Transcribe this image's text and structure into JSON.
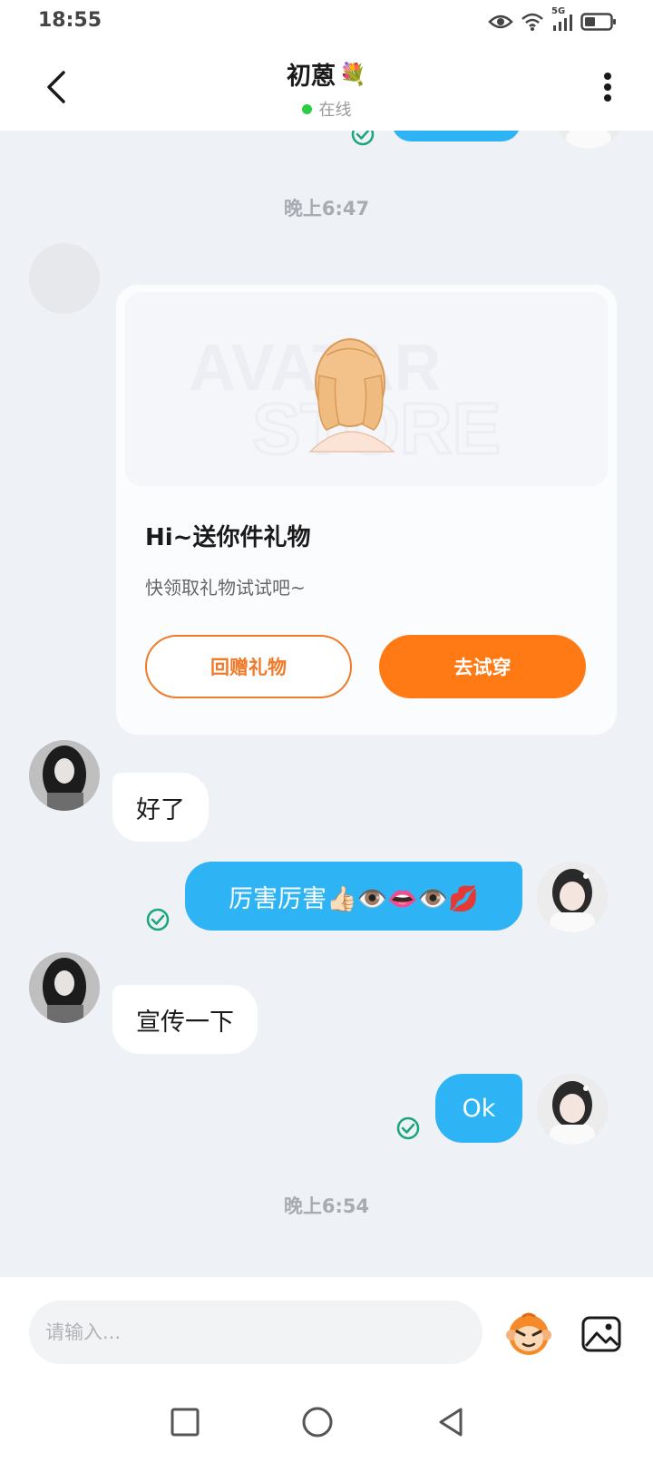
{
  "status_bar": {
    "time": "18:55",
    "network_label": "5G"
  },
  "header": {
    "title": "初蒽",
    "title_emoji": "💐",
    "status": "在线"
  },
  "messages": {
    "timestamp_1": "晚上6:47",
    "gift_card": {
      "title": "Hi~送你件礼物",
      "subtitle": "快领取礼物试试吧~",
      "return_button": "回赠礼物",
      "try_button": "去试穿",
      "image_watermark": "AVATAR STORE"
    },
    "msg_1": "好了",
    "msg_2": "厉害厉害👍🏻👁️👄👁️💋",
    "msg_3": "宣传一下",
    "msg_4": "Ok",
    "timestamp_2": "晚上6:54"
  },
  "input": {
    "placeholder": "请输入..."
  },
  "colors": {
    "accent_blue": "#2eb4f5",
    "accent_orange": "#ff7a14",
    "online_green": "#2ecc40",
    "check_green": "#1aa67a"
  }
}
